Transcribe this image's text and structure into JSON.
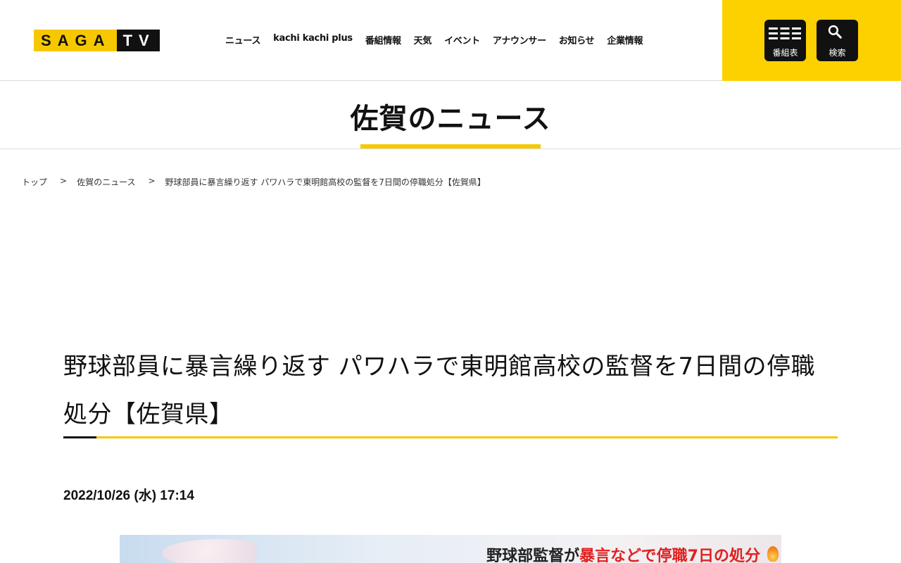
{
  "header": {
    "logo": {
      "left": "SAGA",
      "right": "TV"
    },
    "nav": [
      "ニュース",
      "kachi kachi plus",
      "番組情報",
      "天気",
      "イベント",
      "アナウンサー",
      "お知らせ",
      "企業情報"
    ],
    "program_button_label": "番組表",
    "search_button_label": "検索"
  },
  "section_title": "佐賀のニュース",
  "breadcrumb": {
    "home": "トップ",
    "separator": ">",
    "category": "佐賀のニュース",
    "current": "野球部員に暴言繰り返す パワハラで東明館高校の監督を7日間の停職処分【佐賀県】"
  },
  "article": {
    "title": "野球部員に暴言繰り返す パワハラで東明館高校の監督を7日間の停職処分【佐賀県】",
    "date": "2022/10/26 (水) 17:14",
    "image_caption": {
      "part1": "野球部監督が",
      "part2": "暴言などで停職7日の処分"
    }
  },
  "colors": {
    "accent": "#f7c800",
    "header_box": "#fdd000",
    "text": "#111111",
    "caption_red": "#e02020"
  }
}
